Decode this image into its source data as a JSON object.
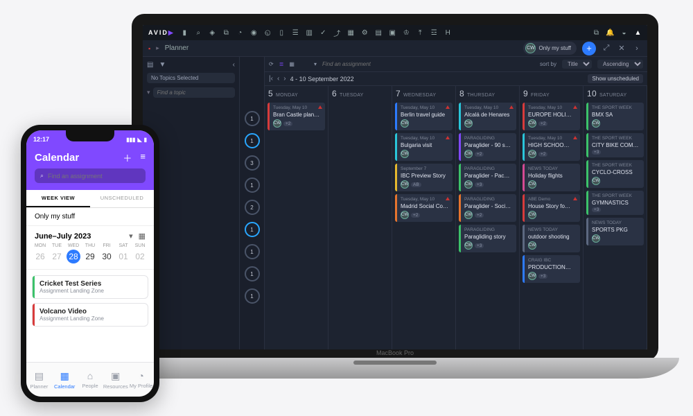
{
  "laptop": {
    "brand": "AVID",
    "breadcrumb": "Planner",
    "only_my_stuff": "Only my stuff",
    "cw": "CW",
    "sidebar": {
      "no_topics": "No Topics Selected",
      "find_topic": "Find a topic"
    },
    "controls": {
      "find_assignment": "Find an assignment",
      "sort_by": "sort by",
      "sort_field": "Title",
      "sort_dir": "Ascending"
    },
    "date_nav": {
      "range": "4 - 10 September 2022",
      "show_unscheduled": "Show unscheduled"
    },
    "lanes": [
      "1",
      "1",
      "3",
      "1",
      "2",
      "1",
      "1",
      "1",
      "1"
    ],
    "columns": [
      {
        "num": "5",
        "dow": "Monday",
        "cards": [
          {
            "stripe": "red",
            "over": "Tuesday, May 10",
            "title": "Bran Castle plan…",
            "cw": true,
            "plus": "+2",
            "tri": true
          }
        ]
      },
      {
        "num": "6",
        "dow": "Tuesday",
        "cards": []
      },
      {
        "num": "7",
        "dow": "Wednesday",
        "cards": [
          {
            "stripe": "blue",
            "over": "Tuesday, May 10",
            "title": "Berlin travel guide",
            "cw": true,
            "plus": "",
            "tri": true
          },
          {
            "stripe": "cyan",
            "over": "Tuesday, May 10",
            "title": "Bulgaria visit",
            "cw": true,
            "plus": "",
            "tri": true
          },
          {
            "stripe": "yellow",
            "over": "September 7",
            "title": "IBC Preview Story",
            "cw": true,
            "plus": "AB",
            "tri": false
          },
          {
            "stripe": "orange",
            "over": "Tuesday, May 10",
            "title": "Madrid Social Co…",
            "cw": true,
            "plus": "+2",
            "tri": true
          }
        ]
      },
      {
        "num": "8",
        "dow": "Thursday",
        "cards": [
          {
            "stripe": "cyan",
            "over": "Tuesday, May 10",
            "title": "Alcalá de Henares",
            "cw": true,
            "plus": "",
            "tri": true
          },
          {
            "stripe": "purple",
            "over": "PARAGLIDING",
            "title": "Paraglider - 90 s…",
            "cw": true,
            "plus": "+2",
            "tri": false
          },
          {
            "stripe": "green",
            "over": "PARAGLIDING",
            "title": "Paraglider - Pac…",
            "cw": true,
            "plus": "+3",
            "tri": false
          },
          {
            "stripe": "orange",
            "over": "PARAGLIDING",
            "title": "Paraglider - Soci…",
            "cw": true,
            "plus": "+2",
            "tri": false
          },
          {
            "stripe": "green",
            "over": "PARAGLIDING",
            "title": "Paragliding story",
            "cw": true,
            "plus": "+3",
            "tri": false
          }
        ]
      },
      {
        "num": "9",
        "dow": "Friday",
        "cards": [
          {
            "stripe": "red",
            "over": "Tuesday, May 10",
            "title": "EUROPE HOLI…",
            "cw": true,
            "plus": "+2",
            "tri": true
          },
          {
            "stripe": "cyan",
            "over": "Tuesday, May 10",
            "title": "HIGH SCHOO…",
            "cw": true,
            "plus": "+2",
            "tri": true
          },
          {
            "stripe": "pink",
            "over": "NEWS TODAY",
            "title": "Holiday flights",
            "cw": true,
            "plus": "",
            "tri": false
          },
          {
            "stripe": "red",
            "over": "ABE Demo",
            "title": "House Story fo…",
            "cw": true,
            "plus": "",
            "tri": true
          },
          {
            "stripe": "slate",
            "over": "NEWS TODAY",
            "title": "outdoor shooting",
            "cw": true,
            "plus": "",
            "tri": false
          },
          {
            "stripe": "blue",
            "over": "CRAIG IBC",
            "title": "PRODUCTION…",
            "cw": true,
            "plus": "+3",
            "tri": false
          }
        ]
      },
      {
        "num": "10",
        "dow": "Saturday",
        "cards": [
          {
            "stripe": "green",
            "over": "THE SPORT WEEK",
            "title": "BMX SA",
            "cw": true,
            "plus": "",
            "tri": false
          },
          {
            "stripe": "green",
            "over": "THE SPORT WEEK",
            "title": "CITY BIKE COM…",
            "cw": false,
            "plus": "+3",
            "tri": false
          },
          {
            "stripe": "green",
            "over": "THE SPORT WEEK",
            "title": "CYCLO-CROSS",
            "cw": true,
            "plus": "",
            "tri": false
          },
          {
            "stripe": "green",
            "over": "THE SPORT WEEK",
            "title": "GYMNASTICS",
            "cw": false,
            "plus": "+3",
            "tri": false
          },
          {
            "stripe": "slate",
            "over": "NEWS TODAY",
            "title": "SPORTS PKG",
            "cw": true,
            "plus": "",
            "tri": false
          }
        ]
      }
    ],
    "hw_label": "MacBook Pro"
  },
  "phone": {
    "time": "12:17",
    "title": "Calendar",
    "search_placeholder": "Find an assignment",
    "tabs": {
      "week": "WEEK VIEW",
      "unscheduled": "UNSCHEDULED"
    },
    "only": "Only my stuff",
    "range_label": "June–July 2023",
    "days": [
      {
        "dow": "MON",
        "num": "26",
        "muted": true
      },
      {
        "dow": "TUE",
        "num": "27",
        "muted": true
      },
      {
        "dow": "WED",
        "num": "28",
        "sel": true
      },
      {
        "dow": "THU",
        "num": "29"
      },
      {
        "dow": "FRI",
        "num": "30"
      },
      {
        "dow": "SAT",
        "num": "01",
        "muted": true
      },
      {
        "dow": "SUN",
        "num": "02",
        "muted": true
      }
    ],
    "cards": [
      {
        "t": "Cricket Test Series",
        "s": "Assignment Landing Zone"
      },
      {
        "t": "Volcano Video",
        "s": "Assignment Landing Zone"
      }
    ],
    "nav": [
      "Planner",
      "Calendar",
      "People",
      "Resources",
      "My Profile"
    ]
  }
}
